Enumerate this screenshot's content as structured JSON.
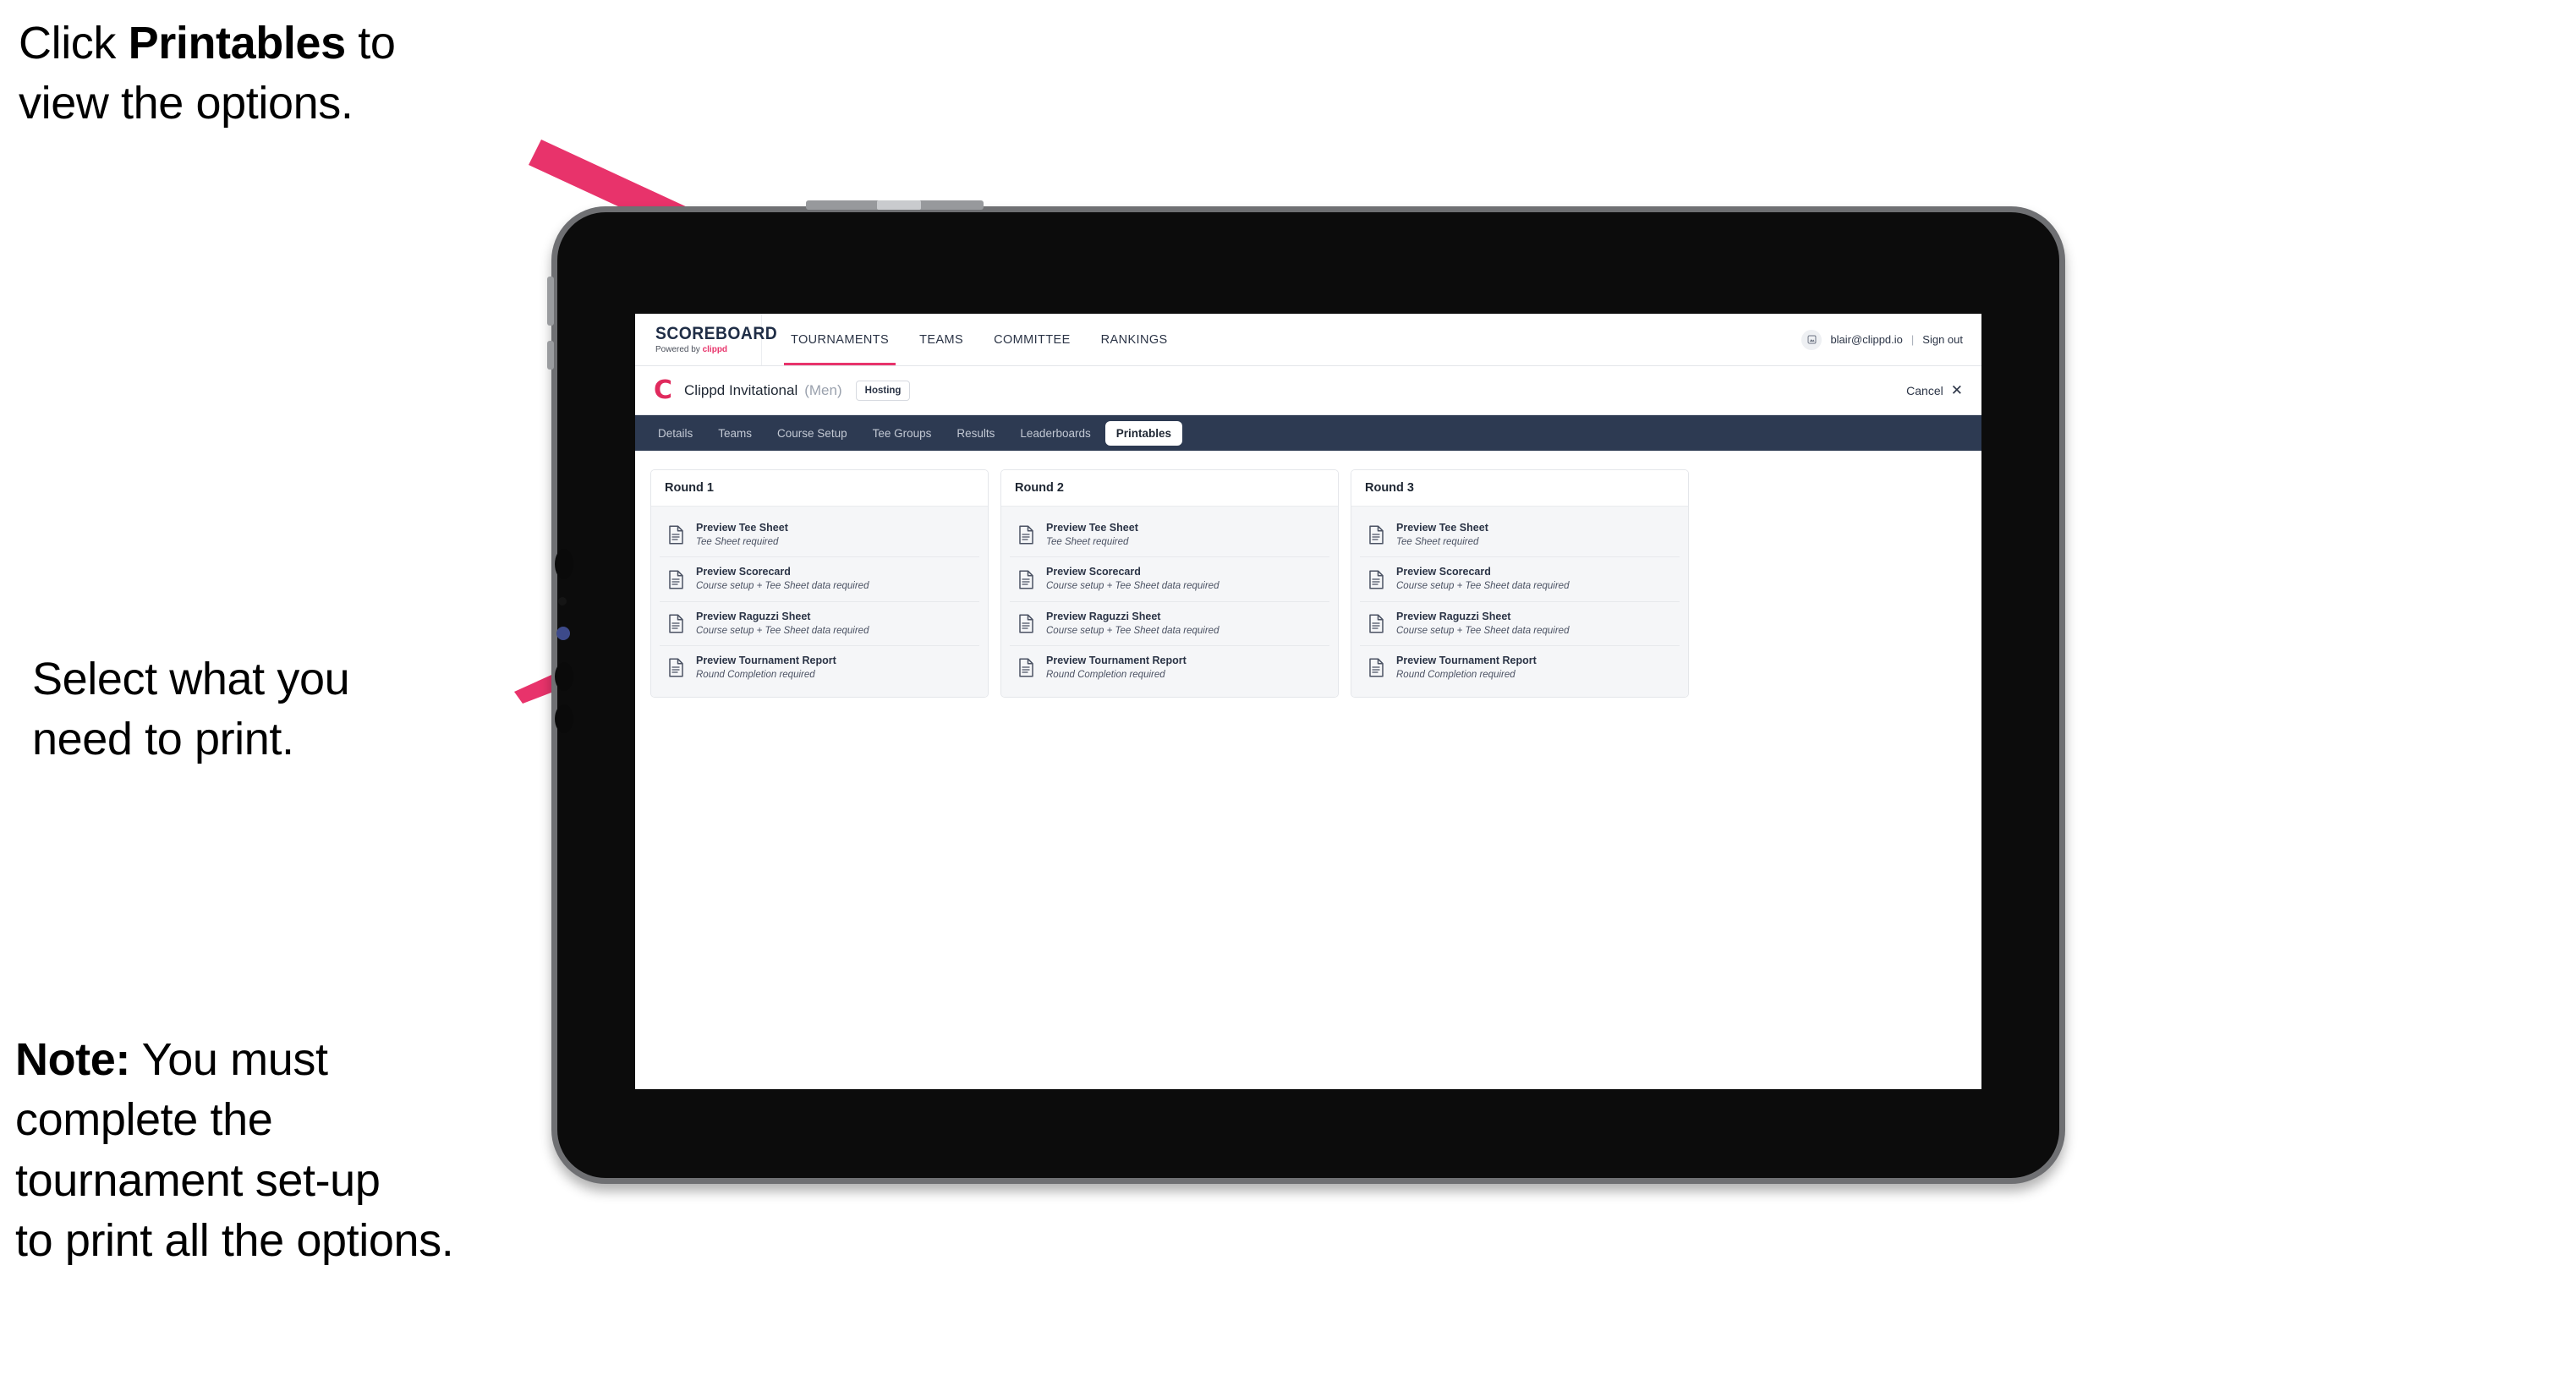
{
  "annotations": [
    {
      "id": "a1",
      "prefix": "Click ",
      "bold": "Printables",
      "suffix": " to\nview the options."
    },
    {
      "id": "a2",
      "prefix": "",
      "bold": "",
      "suffix": "Select what you\n need to print."
    },
    {
      "id": "a3",
      "prefix": "",
      "bold": "Note:",
      "suffix": " You must\ncomplete the\ntournament set-up\nto print all the options."
    }
  ],
  "app": {
    "brand": {
      "name": "SCOREBOARD",
      "powered_prefix": "Powered by ",
      "powered_brand": "clippd"
    },
    "main_nav": [
      {
        "label": "TOURNAMENTS",
        "active": true
      },
      {
        "label": "TEAMS",
        "active": false
      },
      {
        "label": "COMMITTEE",
        "active": false
      },
      {
        "label": "RANKINGS",
        "active": false
      }
    ],
    "account": {
      "avatar_icon": "user-avatar-icon",
      "email": "blair@clippd.io",
      "divider": "|",
      "sign_out": "Sign out"
    },
    "tournament": {
      "logo_letter": "C",
      "name": "Clippd Invitational",
      "gender": "(Men)",
      "status_badge": "Hosting",
      "cancel_label": "Cancel",
      "cancel_icon": "close-x-icon"
    },
    "tabs": [
      {
        "label": "Details",
        "active": false
      },
      {
        "label": "Teams",
        "active": false
      },
      {
        "label": "Course Setup",
        "active": false
      },
      {
        "label": "Tee Groups",
        "active": false
      },
      {
        "label": "Results",
        "active": false
      },
      {
        "label": "Leaderboards",
        "active": false
      },
      {
        "label": "Printables",
        "active": true
      }
    ],
    "rounds": [
      {
        "title": "Round 1",
        "items": [
          {
            "icon": "document-icon",
            "title": "Preview Tee Sheet",
            "subtitle": "Tee Sheet required"
          },
          {
            "icon": "document-icon",
            "title": "Preview Scorecard",
            "subtitle": "Course setup + Tee Sheet data required"
          },
          {
            "icon": "document-icon",
            "title": "Preview Raguzzi Sheet",
            "subtitle": "Course setup + Tee Sheet data required"
          },
          {
            "icon": "document-icon",
            "title": "Preview Tournament Report",
            "subtitle": "Round Completion required"
          }
        ]
      },
      {
        "title": "Round 2",
        "items": [
          {
            "icon": "document-icon",
            "title": "Preview Tee Sheet",
            "subtitle": "Tee Sheet required"
          },
          {
            "icon": "document-icon",
            "title": "Preview Scorecard",
            "subtitle": "Course setup + Tee Sheet data required"
          },
          {
            "icon": "document-icon",
            "title": "Preview Raguzzi Sheet",
            "subtitle": "Course setup + Tee Sheet data required"
          },
          {
            "icon": "document-icon",
            "title": "Preview Tournament Report",
            "subtitle": "Round Completion required"
          }
        ]
      },
      {
        "title": "Round 3",
        "items": [
          {
            "icon": "document-icon",
            "title": "Preview Tee Sheet",
            "subtitle": "Tee Sheet required"
          },
          {
            "icon": "document-icon",
            "title": "Preview Scorecard",
            "subtitle": "Course setup + Tee Sheet data required"
          },
          {
            "icon": "document-icon",
            "title": "Preview Raguzzi Sheet",
            "subtitle": "Course setup + Tee Sheet data required"
          },
          {
            "icon": "document-icon",
            "title": "Preview Tournament Report",
            "subtitle": "Round Completion required"
          }
        ]
      }
    ]
  },
  "colors": {
    "accent_pink": "#e8336b",
    "tabs_bar": "#2d3a52",
    "arrow": "#e8336b",
    "text_dark": "#1f2733"
  }
}
